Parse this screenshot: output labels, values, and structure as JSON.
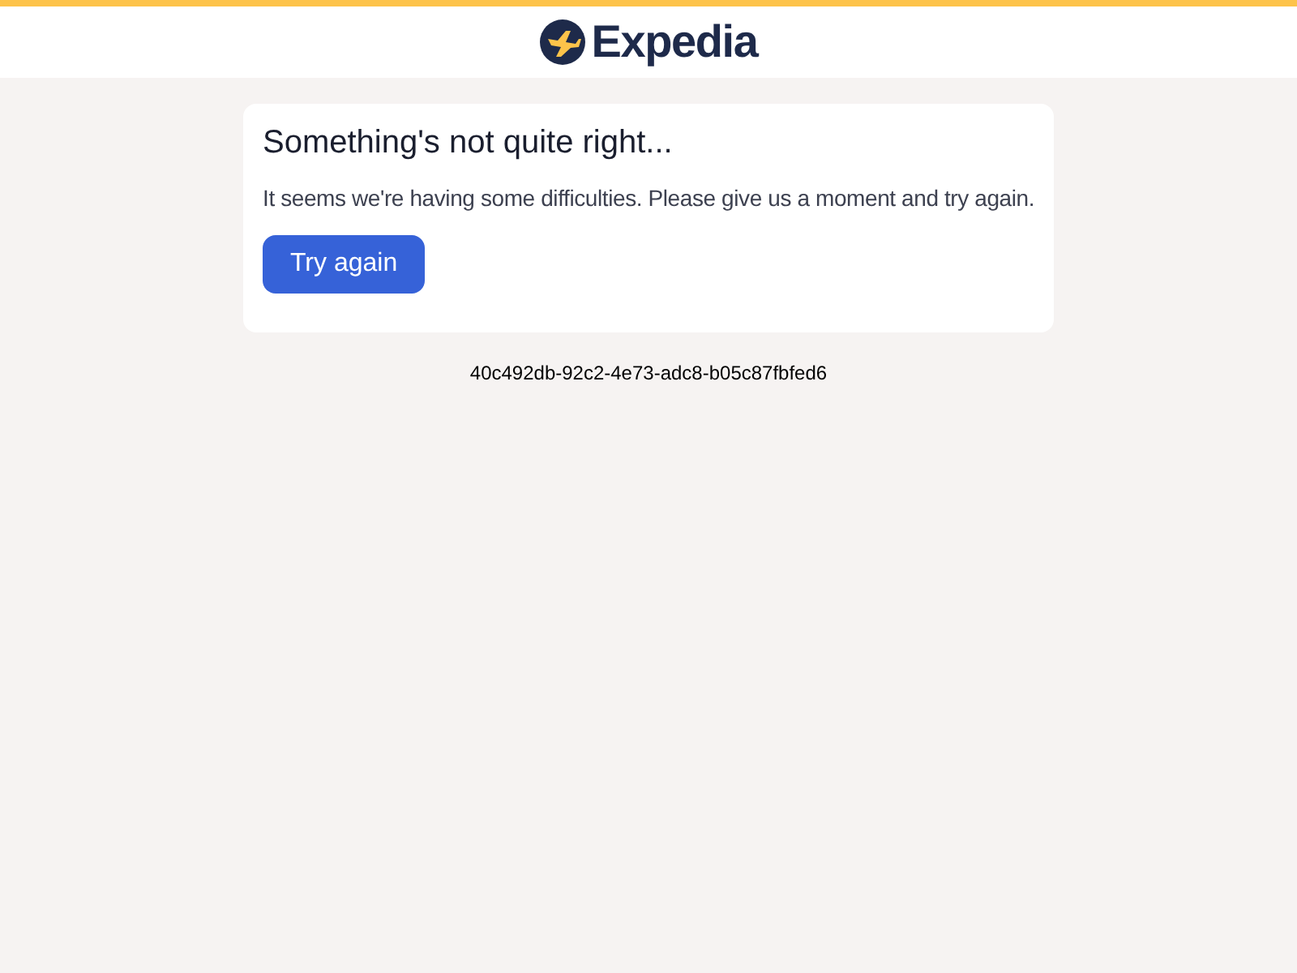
{
  "header": {
    "logo_text": "Expedia"
  },
  "error_card": {
    "title": "Something's not quite right...",
    "message": "It seems we're having some difficulties. Please give us a moment and try again.",
    "button": "Try again"
  },
  "request_id": "40c492db-92c2-4e73-adc8-b05c87fbfed6"
}
